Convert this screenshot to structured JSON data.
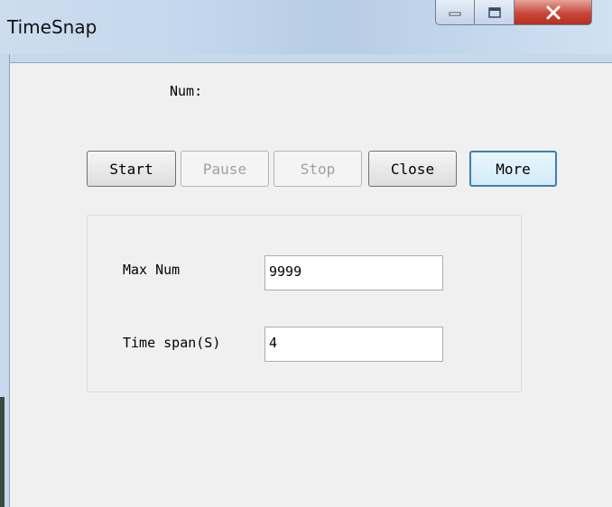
{
  "window": {
    "title": "TimeSnap",
    "minimize_icon": "minimize-icon",
    "maximize_icon": "maximize-icon",
    "close_icon": "close-icon"
  },
  "main": {
    "num_label": "Num:"
  },
  "buttons": {
    "start": "Start",
    "pause": "Pause",
    "stop": "Stop",
    "close": "Close",
    "more": "More"
  },
  "settings": {
    "max_num_label": "Max Num",
    "max_num_value": "9999",
    "time_span_label": "Time span(S)",
    "time_span_value": "4"
  }
}
